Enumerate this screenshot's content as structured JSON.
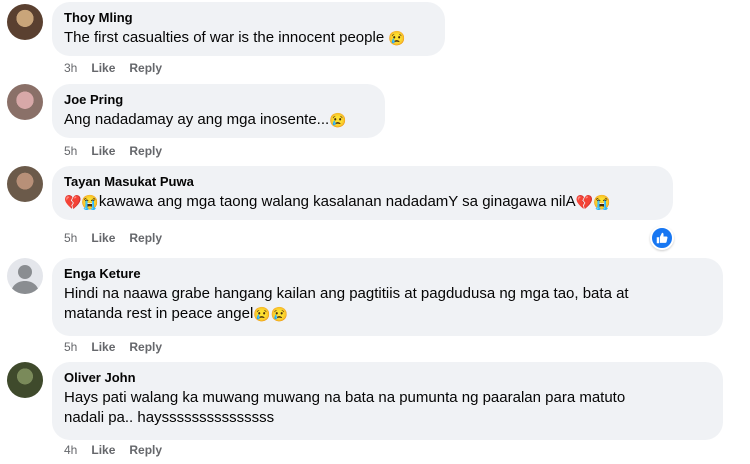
{
  "comments": [
    {
      "author": "Thoy Mling",
      "text": "The first casualties of war is the innocent people",
      "emoji_suffix": "😢",
      "time": "3h",
      "like": "Like",
      "reply": "Reply",
      "avatar_icon": "user-photo-avatar"
    },
    {
      "author": "Joe Pring",
      "text": "Ang nadadamay ay ang mga inosente...",
      "emoji_suffix": "😢",
      "time": "5h",
      "like": "Like",
      "reply": "Reply",
      "avatar_icon": "user-photo-avatar"
    },
    {
      "author": "Tayan Masukat Puwa",
      "emoji_prefix": "💔😭",
      "text": "kawawa ang mga taong walang kasalanan nadadamY sa ginagawa nilA",
      "emoji_suffix": "💔😭",
      "time": "5h",
      "like": "Like",
      "reply": "Reply",
      "avatar_icon": "user-photo-avatar",
      "reaction_icon": "like-reaction-icon"
    },
    {
      "author": "Enga Keture",
      "text_line1": "Hindi na naawa grabe hangang kailan ang pagtitiis at pagdudusa ng mga tao, bata at",
      "text_line2": "matanda rest in peace angel",
      "emoji_suffix": "😢😢",
      "time": "5h",
      "like": "Like",
      "reply": "Reply",
      "avatar_icon": "default-user-avatar"
    },
    {
      "author": "Oliver John",
      "text_line1": "Hays pati walang ka muwang muwang na bata na pumunta ng paaralan para matuto",
      "text_line2": "nadali pa.. haysssssssssssssss",
      "time": "4h",
      "like": "Like",
      "reply": "Reply",
      "avatar_icon": "user-photo-avatar"
    }
  ],
  "colors": {
    "bubble": "#f0f2f5",
    "meta": "#65676b",
    "like_blue": "#1877f2"
  }
}
